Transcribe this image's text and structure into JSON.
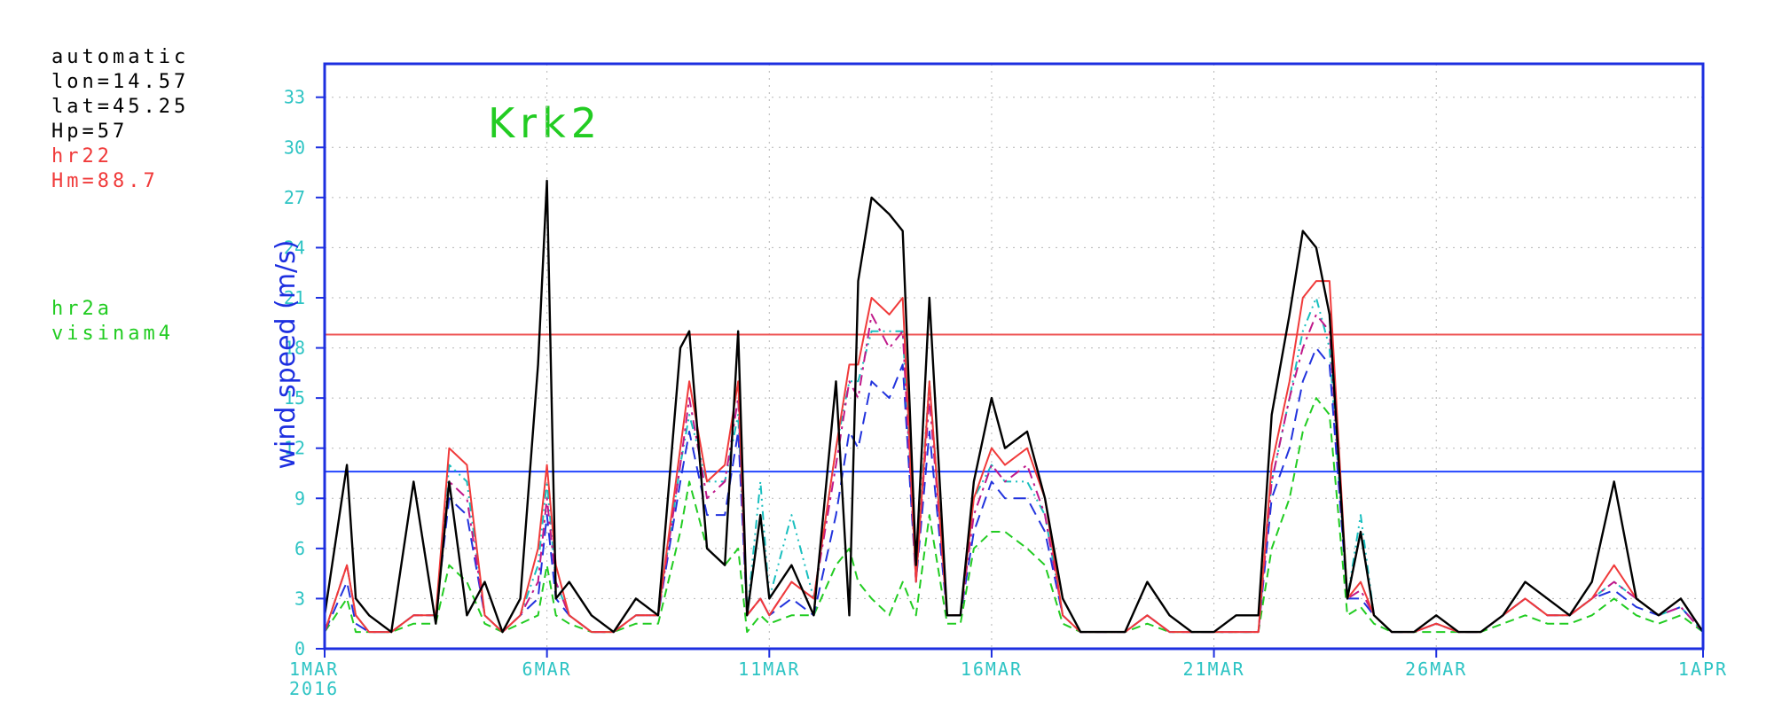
{
  "meta_block": {
    "mode": "automatic",
    "lon": "lon=14.57",
    "lat": "lat=45.25",
    "hp": "Hp=57",
    "model_a": "hr22",
    "hm": "Hm=88.7",
    "model_b": "hr2a",
    "model_c": "visinam4"
  },
  "colors": {
    "axis": "#1d2fe0",
    "tick_text": "#2ec4c4",
    "title": "#22cc22",
    "black": "#000000",
    "red": "#f03a3a",
    "magenta": "#c0198a",
    "blue": "#2233dd",
    "cyan": "#19bfbf",
    "green": "#22cc22",
    "ref_red": "#ee5555",
    "ref_blue": "#2244ff"
  },
  "chart_data": {
    "type": "line",
    "title": "Krk2",
    "ylabel": "wind speed  (m/s)",
    "xlabel": "",
    "ylim": [
      0,
      35
    ],
    "yticks": [
      0,
      3,
      6,
      9,
      12,
      15,
      18,
      21,
      24,
      27,
      30,
      33
    ],
    "xlim_days": [
      1,
      32
    ],
    "x_ticks": [
      {
        "day": 1,
        "label": "1MAR",
        "sublabel": "2016"
      },
      {
        "day": 6,
        "label": "6MAR",
        "sublabel": ""
      },
      {
        "day": 11,
        "label": "11MAR",
        "sublabel": ""
      },
      {
        "day": 16,
        "label": "16MAR",
        "sublabel": ""
      },
      {
        "day": 21,
        "label": "21MAR",
        "sublabel": ""
      },
      {
        "day": 26,
        "label": "26MAR",
        "sublabel": ""
      },
      {
        "day": 32,
        "label": "1APR",
        "sublabel": ""
      }
    ],
    "grid": true,
    "reference_lines": [
      {
        "y": 18.8,
        "color": "#ee5555"
      },
      {
        "y": 10.6,
        "color": "#2244ff"
      }
    ],
    "x": [
      1.0,
      1.5,
      1.7,
      2.0,
      2.5,
      3.0,
      3.5,
      3.8,
      4.2,
      4.6,
      5.0,
      5.4,
      5.8,
      6.0,
      6.2,
      6.5,
      7.0,
      7.5,
      8.0,
      8.5,
      9.0,
      9.2,
      9.6,
      10.0,
      10.3,
      10.5,
      10.8,
      11.0,
      11.5,
      12.0,
      12.5,
      12.8,
      13.0,
      13.3,
      13.7,
      14.0,
      14.3,
      14.6,
      15.0,
      15.3,
      15.6,
      16.0,
      16.3,
      16.8,
      17.2,
      17.6,
      18.0,
      18.5,
      19.0,
      19.5,
      20.0,
      20.5,
      21.0,
      21.5,
      22.0,
      22.3,
      22.7,
      23.0,
      23.3,
      23.6,
      24.0,
      24.3,
      24.6,
      25.0,
      25.5,
      26.0,
      26.5,
      27.0,
      27.5,
      28.0,
      28.5,
      29.0,
      29.5,
      30.0,
      30.5,
      31.0,
      31.5,
      32.0
    ],
    "series": [
      {
        "name": "",
        "color": "#000000",
        "dash": "",
        "width": 2.4,
        "values": [
          2.0,
          11.0,
          3.0,
          2.0,
          1.0,
          10.0,
          1.5,
          10.0,
          2.0,
          4.0,
          1.0,
          3.0,
          17.0,
          28.0,
          3.0,
          4.0,
          2.0,
          1.0,
          3.0,
          2.0,
          18.0,
          19.0,
          6.0,
          5.0,
          19.0,
          2.0,
          8.0,
          3.0,
          5.0,
          2.0,
          16.0,
          2.0,
          22.0,
          27.0,
          26.0,
          25.0,
          5.0,
          21.0,
          2.0,
          2.0,
          10.0,
          15.0,
          12.0,
          13.0,
          9.0,
          3.0,
          1.0,
          1.0,
          1.0,
          4.0,
          2.0,
          1.0,
          1.0,
          2.0,
          2.0,
          14.0,
          20.0,
          25.0,
          24.0,
          20.0,
          3.0,
          7.0,
          2.0,
          1.0,
          1.0,
          2.0,
          1.0,
          1.0,
          2.0,
          4.0,
          3.0,
          2.0,
          4.0,
          10.0,
          3.0,
          2.0,
          3.0,
          1.0
        ]
      },
      {
        "name": "hr22",
        "color": "#f03a3a",
        "dash": "",
        "width": 2,
        "values": [
          1.0,
          5.0,
          2.0,
          1.0,
          1.0,
          2.0,
          2.0,
          12.0,
          11.0,
          2.0,
          1.0,
          2.0,
          6.0,
          11.0,
          5.0,
          2.0,
          1.0,
          1.0,
          2.0,
          2.0,
          12.0,
          16.0,
          10.0,
          11.0,
          16.0,
          2.0,
          3.0,
          2.0,
          4.0,
          3.0,
          12.0,
          17.0,
          17.0,
          21.0,
          20.0,
          21.0,
          4.0,
          16.0,
          2.0,
          2.0,
          9.0,
          12.0,
          11.0,
          12.0,
          9.0,
          2.0,
          1.0,
          1.0,
          1.0,
          2.0,
          1.0,
          1.0,
          1.0,
          1.0,
          1.0,
          11.0,
          16.0,
          21.0,
          22.0,
          22.0,
          3.0,
          4.0,
          2.0,
          1.0,
          1.0,
          1.5,
          1.0,
          1.0,
          2.0,
          3.0,
          2.0,
          2.0,
          3.0,
          5.0,
          3.0,
          2.0,
          3.0,
          1.0
        ]
      },
      {
        "name": "",
        "color": "#c0198a",
        "dash": "12,6,3,6",
        "width": 2,
        "values": [
          1.0,
          5.0,
          2.0,
          1.0,
          1.0,
          2.0,
          2.0,
          10.0,
          9.0,
          2.0,
          1.0,
          2.0,
          4.0,
          9.0,
          4.0,
          2.0,
          1.0,
          1.0,
          2.0,
          2.0,
          11.0,
          15.0,
          9.0,
          10.0,
          15.0,
          2.0,
          3.0,
          2.0,
          4.0,
          3.0,
          11.0,
          16.0,
          15.0,
          20.0,
          18.0,
          19.0,
          4.0,
          15.0,
          2.0,
          2.0,
          8.0,
          11.0,
          10.0,
          11.0,
          8.0,
          2.0,
          1.0,
          1.0,
          1.0,
          2.0,
          1.0,
          1.0,
          1.0,
          1.0,
          1.0,
          10.0,
          15.0,
          18.0,
          20.0,
          19.0,
          3.0,
          3.5,
          2.0,
          1.0,
          1.0,
          1.5,
          1.0,
          1.0,
          2.0,
          3.0,
          2.0,
          2.0,
          3.0,
          4.0,
          3.0,
          2.0,
          2.5,
          1.0
        ]
      },
      {
        "name": "",
        "color": "#2233dd",
        "dash": "14,8",
        "width": 2,
        "values": [
          1.0,
          4.0,
          1.5,
          1.0,
          1.0,
          2.0,
          2.0,
          9.0,
          8.0,
          2.0,
          1.0,
          2.0,
          3.0,
          8.0,
          3.0,
          2.0,
          1.0,
          1.0,
          2.0,
          2.0,
          10.0,
          13.0,
          8.0,
          8.0,
          13.0,
          2.0,
          3.0,
          2.0,
          3.0,
          2.0,
          8.0,
          13.0,
          12.0,
          16.0,
          15.0,
          17.0,
          4.0,
          13.0,
          2.0,
          2.0,
          7.0,
          10.0,
          9.0,
          9.0,
          7.0,
          2.0,
          1.0,
          1.0,
          1.0,
          2.0,
          1.0,
          1.0,
          1.0,
          1.0,
          1.0,
          9.0,
          12.0,
          16.0,
          18.0,
          17.0,
          3.0,
          3.0,
          2.0,
          1.0,
          1.0,
          1.5,
          1.0,
          1.0,
          2.0,
          3.0,
          2.0,
          2.0,
          3.0,
          3.5,
          2.5,
          2.0,
          2.5,
          1.0
        ]
      },
      {
        "name": "hr2a",
        "color": "#19bfbf",
        "dash": "10,5,2,5,2,5",
        "width": 2,
        "values": [
          1.0,
          5.0,
          2.0,
          1.0,
          1.0,
          2.0,
          2.0,
          11.0,
          10.0,
          2.0,
          1.0,
          2.0,
          5.0,
          10.0,
          4.0,
          2.0,
          1.0,
          1.0,
          2.0,
          2.0,
          11.0,
          14.0,
          10.0,
          10.0,
          14.0,
          2.0,
          10.0,
          3.0,
          8.0,
          3.0,
          12.0,
          16.0,
          16.0,
          19.0,
          19.0,
          19.0,
          5.0,
          16.0,
          2.0,
          2.0,
          9.0,
          11.0,
          10.0,
          10.0,
          8.0,
          2.0,
          1.0,
          1.0,
          1.0,
          2.0,
          1.0,
          1.0,
          1.0,
          1.0,
          1.0,
          10.0,
          15.0,
          19.0,
          21.0,
          18.0,
          3.0,
          8.0,
          2.0,
          1.0,
          1.0,
          1.5,
          1.0,
          1.0,
          2.0,
          3.0,
          2.0,
          2.0,
          3.0,
          4.0,
          3.0,
          2.0,
          2.5,
          1.0
        ]
      },
      {
        "name": "visinam4",
        "color": "#22cc22",
        "dash": "10,6",
        "width": 2,
        "values": [
          1.0,
          3.0,
          1.0,
          1.0,
          1.0,
          1.5,
          1.5,
          5.0,
          4.0,
          1.5,
          1.0,
          1.5,
          2.0,
          5.0,
          2.0,
          1.5,
          1.0,
          1.0,
          1.5,
          1.5,
          7.0,
          10.0,
          6.0,
          5.0,
          6.0,
          1.0,
          2.0,
          1.5,
          2.0,
          2.0,
          5.0,
          6.0,
          4.0,
          3.0,
          2.0,
          4.0,
          2.0,
          8.0,
          1.5,
          1.5,
          6.0,
          7.0,
          7.0,
          6.0,
          5.0,
          1.5,
          1.0,
          1.0,
          1.0,
          1.5,
          1.0,
          1.0,
          1.0,
          1.0,
          1.0,
          6.0,
          9.0,
          13.0,
          15.0,
          14.0,
          2.0,
          2.5,
          1.5,
          1.0,
          1.0,
          1.0,
          1.0,
          1.0,
          1.5,
          2.0,
          1.5,
          1.5,
          2.0,
          3.0,
          2.0,
          1.5,
          2.0,
          1.0
        ]
      }
    ]
  }
}
